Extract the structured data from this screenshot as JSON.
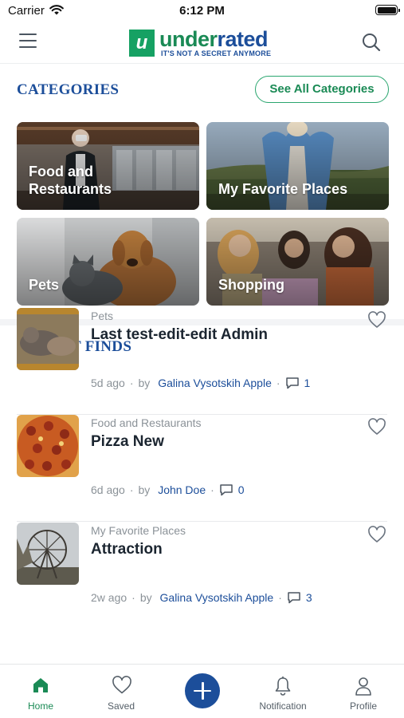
{
  "status_bar": {
    "carrier": "Carrier",
    "time": "6:12 PM"
  },
  "header": {
    "logo_mark": "u",
    "logo_word_a": "under",
    "logo_word_b": "rated",
    "logo_tagline": "IT'S NOT A SECRET ANYMORE"
  },
  "categories": {
    "title": "CATEGORIES",
    "see_all_label": "See All Categories",
    "tiles": [
      {
        "label": "Food and Restaurants"
      },
      {
        "label": "My Favorite Places"
      },
      {
        "label": "Pets"
      },
      {
        "label": "Shopping"
      }
    ]
  },
  "recent": {
    "title": "RECENT FINDS",
    "by_label": "by",
    "items": [
      {
        "category": "Pets",
        "title": "Last test-edit-edit Admin",
        "age": "5d ago",
        "author": "Galina Vysotskih Apple",
        "comments": "1"
      },
      {
        "category": "Food and Restaurants",
        "title": "Pizza New",
        "age": "6d ago",
        "author": "John Doe",
        "comments": "0"
      },
      {
        "category": "My Favorite Places",
        "title": "Attraction",
        "age": "2w ago",
        "author": "Galina Vysotskih Apple",
        "comments": "3"
      }
    ]
  },
  "tabbar": {
    "home": "Home",
    "saved": "Saved",
    "notification": "Notification",
    "profile": "Profile"
  },
  "colors": {
    "brand_green": "#1a8a55",
    "brand_blue": "#1c4e9a",
    "muted_text": "#8b9298"
  }
}
